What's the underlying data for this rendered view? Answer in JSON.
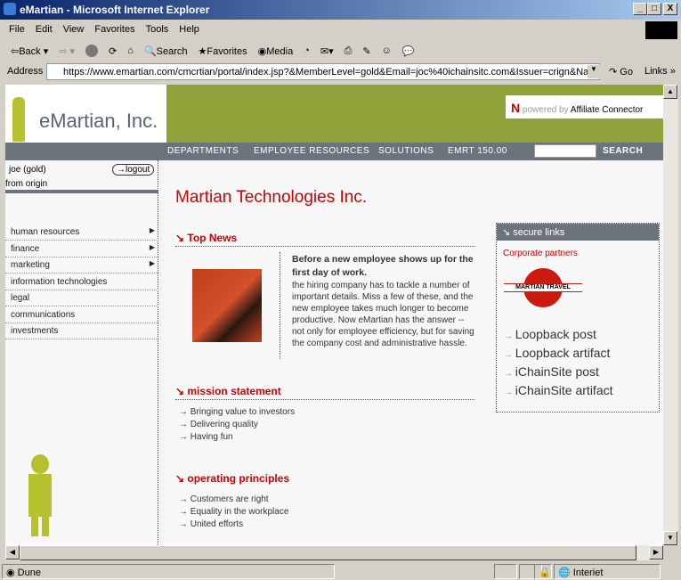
{
  "window": {
    "title": "eMartian - Microsoft Internet Explorer",
    "buttons": [
      "_",
      "□",
      "X"
    ]
  },
  "menu": [
    "File",
    "Edit",
    "View",
    "Favorites",
    "Tools",
    "Help"
  ],
  "toolbar": {
    "back": "Back",
    "search": "Search",
    "favorites": "Favorites",
    "media": "Media"
  },
  "address": {
    "label": "Address",
    "url": "https://www.emartian.com/cmcrtian/portal/index.jsp?&MemberLevel=gold&Email=joc%40ichainsitc.com&Issuer=crign&Name=joc",
    "go": "Go",
    "links": "Links"
  },
  "header": {
    "logo_text": "eMartian, Inc.",
    "powered_by": "powered by",
    "affiliate": "Affiliate Connector",
    "n_logo": "N"
  },
  "nav": {
    "items": [
      "DEPARTMENTS",
      "EMPLOYEE RESOURCES",
      "SOLUTIONS",
      "EMRT 150.00"
    ],
    "search_value": "",
    "search_button": "SEARCH"
  },
  "sidebar": {
    "user": "joe (gold)",
    "logout": "logout",
    "from": "from origin",
    "items": [
      {
        "label": "human resources",
        "arrow": true
      },
      {
        "label": "finance",
        "arrow": true
      },
      {
        "label": "marketing",
        "arrow": true
      },
      {
        "label": "information technologies",
        "arrow": false
      },
      {
        "label": "legal",
        "arrow": false
      },
      {
        "label": "communications",
        "arrow": false
      },
      {
        "label": "investments",
        "arrow": false
      }
    ]
  },
  "main": {
    "title": "Martian Technologies Inc.",
    "top_news": {
      "heading": "Top News",
      "headline": "Before a new employee shows up for the first day of work.",
      "body": "the hiring company has to tackle a number of important details. Miss a few of these, and the new employee takes much longer to become productive. Now eMartian has the answer -- not only for employee efficiency, but for saving the company cost and administrative hassle."
    },
    "mission": {
      "heading": "mission statement",
      "items": [
        "Bringing value to investors",
        "Delivering quality",
        "Having fun"
      ]
    },
    "principles": {
      "heading": "operating principles",
      "items": [
        "Customers are right",
        "Equality in the workplace",
        "United efforts"
      ]
    }
  },
  "secure_links": {
    "heading": "secure links",
    "partners": "Corporate partners",
    "travel_logo": "MARTIAN TRAVEL",
    "links": [
      "Loopback post",
      "Loopback artifact",
      "iChainSite post",
      "iChainSite artifact"
    ]
  },
  "status": {
    "text": "Dune",
    "zone": "Interiet"
  },
  "colors": {
    "accent": "#cc0000",
    "banner": "#8fa33a",
    "nav": "#6b747c"
  }
}
